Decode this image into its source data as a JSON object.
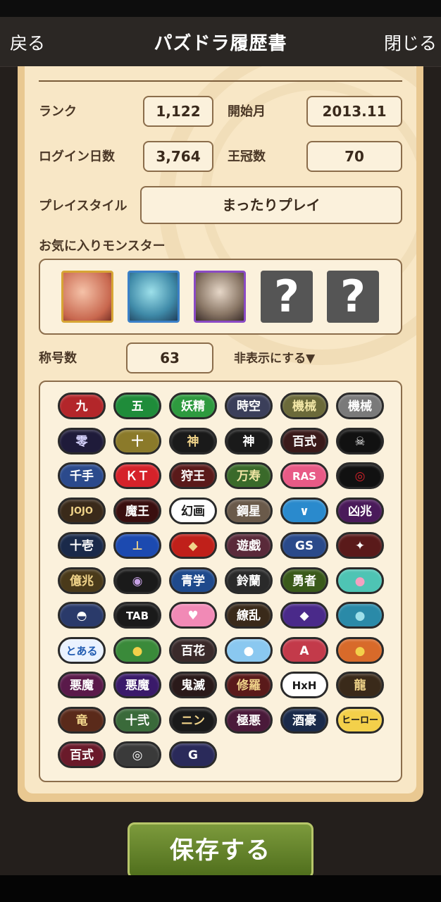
{
  "nav": {
    "back": "戻る",
    "title": "パズドラ履歴書",
    "close": "閉じる"
  },
  "profile": {
    "rank_label": "ランク",
    "rank": "1,122",
    "start_label": "開始月",
    "start": "2013.11",
    "login_label": "ログイン日数",
    "login": "3,764",
    "crown_label": "王冠数",
    "crown": "70",
    "style_label": "プレイスタイル",
    "style": "まったりプレイ",
    "fav_label": "お気に入りモンスター",
    "fav_placeholder": "?",
    "titles_label": "称号数",
    "titles_count": "63",
    "hide_link": "非表示にする▼"
  },
  "titles": [
    {
      "t": "九",
      "bg": "#b3262a",
      "fg": "#ffffff"
    },
    {
      "t": "五",
      "bg": "#1f8c3a",
      "fg": "#ffffff"
    },
    {
      "t": "妖精",
      "bg": "#2e9a3f",
      "fg": "#ffffff"
    },
    {
      "t": "時空",
      "bg": "#3b3f5a",
      "fg": "#ffffff"
    },
    {
      "t": "機械",
      "bg": "#6b6a3a",
      "fg": "#f1e6a6"
    },
    {
      "t": "機械",
      "bg": "#7a7a7a",
      "fg": "#ffffff"
    },
    {
      "t": "零",
      "bg": "#1f1b3a",
      "fg": "#d8d4ff"
    },
    {
      "t": "十",
      "bg": "#8b7a2a",
      "fg": "#ffffff"
    },
    {
      "t": "神",
      "bg": "#1a1a1a",
      "fg": "#f1d48a"
    },
    {
      "t": "神",
      "bg": "#1a1a1a",
      "fg": "#ffffff"
    },
    {
      "t": "百式",
      "bg": "#3a1a1a",
      "fg": "#ffffff"
    },
    {
      "t": "☠",
      "bg": "#111111",
      "fg": "#ffffff"
    },
    {
      "t": "千手",
      "bg": "#2b4a8c",
      "fg": "#ffffff"
    },
    {
      "t": "ＫＴ",
      "bg": "#d5222a",
      "fg": "#ffffff"
    },
    {
      "t": "狩王",
      "bg": "#5a1a1a",
      "fg": "#ffffff"
    },
    {
      "t": "万寿",
      "bg": "#3a6a2a",
      "fg": "#f1e6a6"
    },
    {
      "t": "RAS",
      "bg": "#e85a86",
      "fg": "#ffffff"
    },
    {
      "t": "◎",
      "bg": "#111111",
      "fg": "#d5222a"
    },
    {
      "t": "JOJO",
      "bg": "#3a2a1a",
      "fg": "#f1d48a"
    },
    {
      "t": "魔王",
      "bg": "#3a0f0f",
      "fg": "#ffffff"
    },
    {
      "t": "幻画",
      "bg": "#ffffff",
      "fg": "#1a1a1a"
    },
    {
      "t": "鋼星",
      "bg": "#6a5a4a",
      "fg": "#ffffff"
    },
    {
      "t": "∨",
      "bg": "#2a8acd",
      "fg": "#ffffff"
    },
    {
      "t": "凶兆",
      "bg": "#4a1a5a",
      "fg": "#ffffff"
    },
    {
      "t": "十壱",
      "bg": "#1a2a4a",
      "fg": "#ffffff"
    },
    {
      "t": "⊥",
      "bg": "#1c4ab0",
      "fg": "#f1d48a"
    },
    {
      "t": "◆",
      "bg": "#c0201a",
      "fg": "#f1d48a"
    },
    {
      "t": "遊戯",
      "bg": "#5a2a3a",
      "fg": "#ffffff"
    },
    {
      "t": "GS",
      "bg": "#2a4a8a",
      "fg": "#ffffff"
    },
    {
      "t": "✦",
      "bg": "#5a1a1a",
      "fg": "#ffffff"
    },
    {
      "t": "億兆",
      "bg": "#4a3a1a",
      "fg": "#f1d48a"
    },
    {
      "t": "◉",
      "bg": "#1a1a1a",
      "fg": "#c7a1e5"
    },
    {
      "t": "青学",
      "bg": "#1f4a8c",
      "fg": "#ffffff"
    },
    {
      "t": "鈴蘭",
      "bg": "#2a2a2a",
      "fg": "#ffffff"
    },
    {
      "t": "勇者",
      "bg": "#3a5a1a",
      "fg": "#ffffff"
    },
    {
      "t": "●",
      "bg": "#4ec4b4",
      "fg": "#f3a1c1"
    },
    {
      "t": "◓",
      "bg": "#2a3a6a",
      "fg": "#ffffff"
    },
    {
      "t": "TAB",
      "bg": "#1a1a1a",
      "fg": "#ffffff"
    },
    {
      "t": "♥",
      "bg": "#f18ab6",
      "fg": "#ffffff"
    },
    {
      "t": "繚乱",
      "bg": "#3a2a1a",
      "fg": "#ffffff"
    },
    {
      "t": "◆",
      "bg": "#4a2a8a",
      "fg": "#ffffff"
    },
    {
      "t": "●",
      "bg": "#2a8aa8",
      "fg": "#9de0ea"
    },
    {
      "t": "とある",
      "bg": "#eaf2ff",
      "fg": "#1f5ab0"
    },
    {
      "t": "●",
      "bg": "#3a8a3a",
      "fg": "#f3d04a"
    },
    {
      "t": "百花",
      "bg": "#3a2a2a",
      "fg": "#ffffff"
    },
    {
      "t": "●",
      "bg": "#8ac8f0",
      "fg": "#ffffff"
    },
    {
      "t": "A",
      "bg": "#c33a4a",
      "fg": "#ffffff"
    },
    {
      "t": "●",
      "bg": "#d86a2a",
      "fg": "#f3d04a"
    },
    {
      "t": "悪魔",
      "bg": "#5a1a4a",
      "fg": "#ffffff"
    },
    {
      "t": "悪魔",
      "bg": "#3a1a6a",
      "fg": "#ffffff"
    },
    {
      "t": "鬼滅",
      "bg": "#2a1a1a",
      "fg": "#ffffff"
    },
    {
      "t": "修羅",
      "bg": "#5a1a1a",
      "fg": "#f1d48a"
    },
    {
      "t": "HxH",
      "bg": "#ffffff",
      "fg": "#1a1a1a"
    },
    {
      "t": "龍",
      "bg": "#3a2a1a",
      "fg": "#f1d48a"
    },
    {
      "t": "竜",
      "bg": "#5a2a1a",
      "fg": "#f1d48a"
    },
    {
      "t": "十弐",
      "bg": "#3a6a3a",
      "fg": "#ffffff"
    },
    {
      "t": "ニン",
      "bg": "#1a1a1a",
      "fg": "#f1d48a"
    },
    {
      "t": "極悪",
      "bg": "#4a1a3a",
      "fg": "#ffffff"
    },
    {
      "t": "酒豪",
      "bg": "#1a2a4a",
      "fg": "#ffffff"
    },
    {
      "t": "ヒーロー",
      "bg": "#f3d04a",
      "fg": "#1a1a1a"
    },
    {
      "t": "百式",
      "bg": "#6a1a2a",
      "fg": "#ffffff"
    },
    {
      "t": "◎",
      "bg": "#3a3a3a",
      "fg": "#ffffff"
    },
    {
      "t": "G",
      "bg": "#2a2a5a",
      "fg": "#ffffff"
    }
  ],
  "save_label": "保存する"
}
